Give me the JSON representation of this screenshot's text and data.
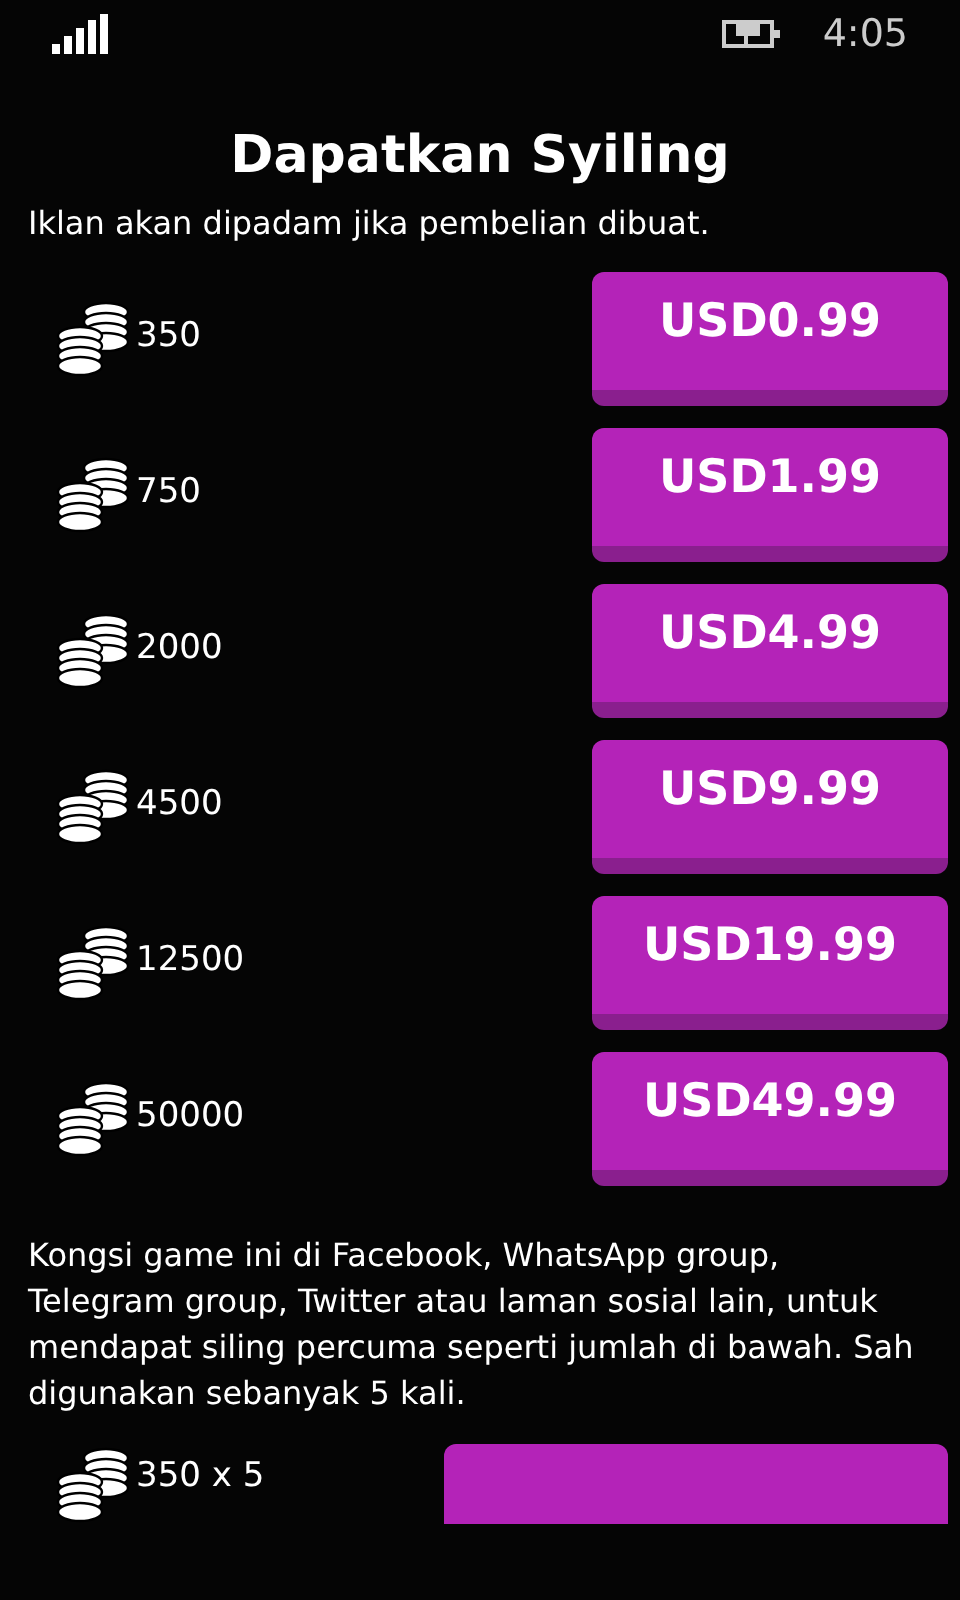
{
  "status_bar": {
    "time": "4:05"
  },
  "title": "Dapatkan Syiling",
  "subtitle": "Iklan akan dipadam jika pembelian dibuat.",
  "packs": [
    {
      "amount": "350",
      "price": "USD0.99"
    },
    {
      "amount": "750",
      "price": "USD1.99"
    },
    {
      "amount": "2000",
      "price": "USD4.99"
    },
    {
      "amount": "4500",
      "price": "USD9.99"
    },
    {
      "amount": "12500",
      "price": "USD19.99"
    },
    {
      "amount": "50000",
      "price": "USD49.99"
    }
  ],
  "share_text": "Kongsi game ini di Facebook, WhatsApp group, Telegram group, Twitter atau laman sosial lain, untuk mendapat siling percuma seperti jumlah di bawah. Sah digunakan sebanyak 5 kali.",
  "share_reward": {
    "amount": "350 x 5"
  }
}
